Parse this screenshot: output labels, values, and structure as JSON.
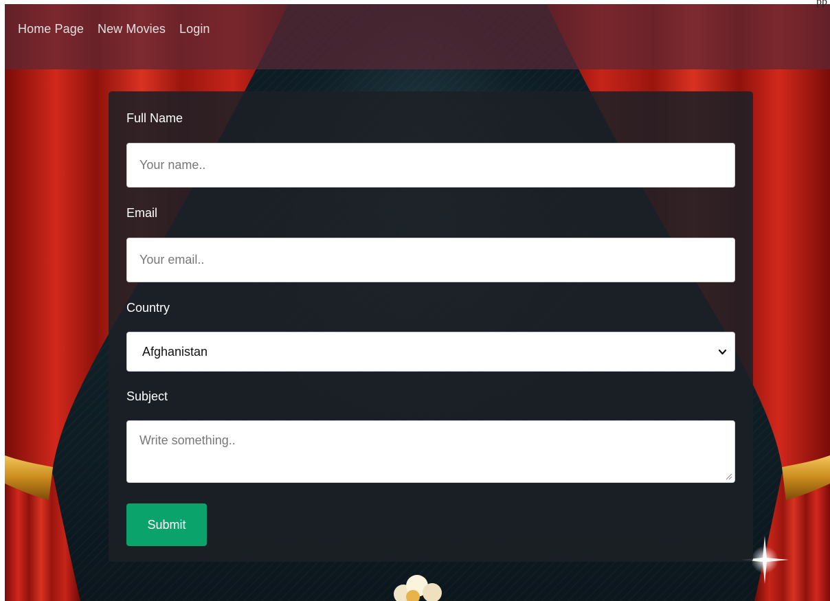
{
  "navbar": {
    "links": [
      {
        "label": "Home Page"
      },
      {
        "label": "New Movies"
      },
      {
        "label": "Login"
      }
    ]
  },
  "top_partial_text": "pp",
  "form": {
    "full_name": {
      "label": "Full Name",
      "placeholder": "Your name..",
      "value": ""
    },
    "email": {
      "label": "Email",
      "placeholder": "Your email..",
      "value": ""
    },
    "country": {
      "label": "Country",
      "selected": "Afghanistan"
    },
    "subject": {
      "label": "Subject",
      "placeholder": "Write something..",
      "value": ""
    },
    "submit_label": "Submit"
  },
  "colors": {
    "submit_bg": "#0aa36b",
    "navbar_bg": "#5a2834",
    "card_bg": "#1c2026",
    "curtain_red": "#c8221a",
    "curtain_gold": "#e0a12c"
  }
}
